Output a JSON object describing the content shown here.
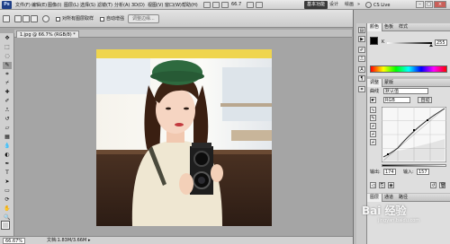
{
  "app": {
    "logo": "Ps"
  },
  "menu": {
    "items": [
      "文件(F)",
      "编辑(E)",
      "图像(I)",
      "图层(L)",
      "选择(S)",
      "滤镜(T)",
      "分析(A)",
      "3D(D)",
      "视图(V)",
      "窗口(W)",
      "帮助(H)"
    ],
    "zoom_value": "66.7",
    "workspace_active": "基本功能",
    "workspace_items": [
      "设计",
      "绘画"
    ],
    "search_label": "CS Live"
  },
  "options": {
    "feather_label": "羽化:",
    "feather_value": "0 px",
    "antialias_label": "消除锯齿",
    "style_label": "对所有图层取样",
    "auto_enhance_label": "自动增强",
    "refine_button": "调整边缘..."
  },
  "document": {
    "tab_title": "1.jpg @ 66.7% (RGB/8) *",
    "status_zoom": "66.67%",
    "status_doc": "文档:1.83M/3.66M"
  },
  "colors": {
    "foreground": "#000000",
    "background": "#ffffff",
    "curve": "#2a2a2a"
  },
  "panels": {
    "color_tab": "颜色",
    "swatches_tab": "色板",
    "styles_tab": "样式",
    "color_value": "255",
    "adjust_tab": "调整",
    "masks_tab": "蒙版",
    "preset_label": "曲线",
    "preset_value": "默认值",
    "channel_value": "RGB",
    "auto_button": "自动",
    "output_label": "输出:",
    "output_value": "174",
    "input_label": "输入:",
    "input_value": "157",
    "layers_tab": "图层",
    "channels_tab": "通道",
    "paths_tab": "路径"
  },
  "watermark": {
    "text": "Bai 经验",
    "sub": "jingyan.baidu.com"
  }
}
